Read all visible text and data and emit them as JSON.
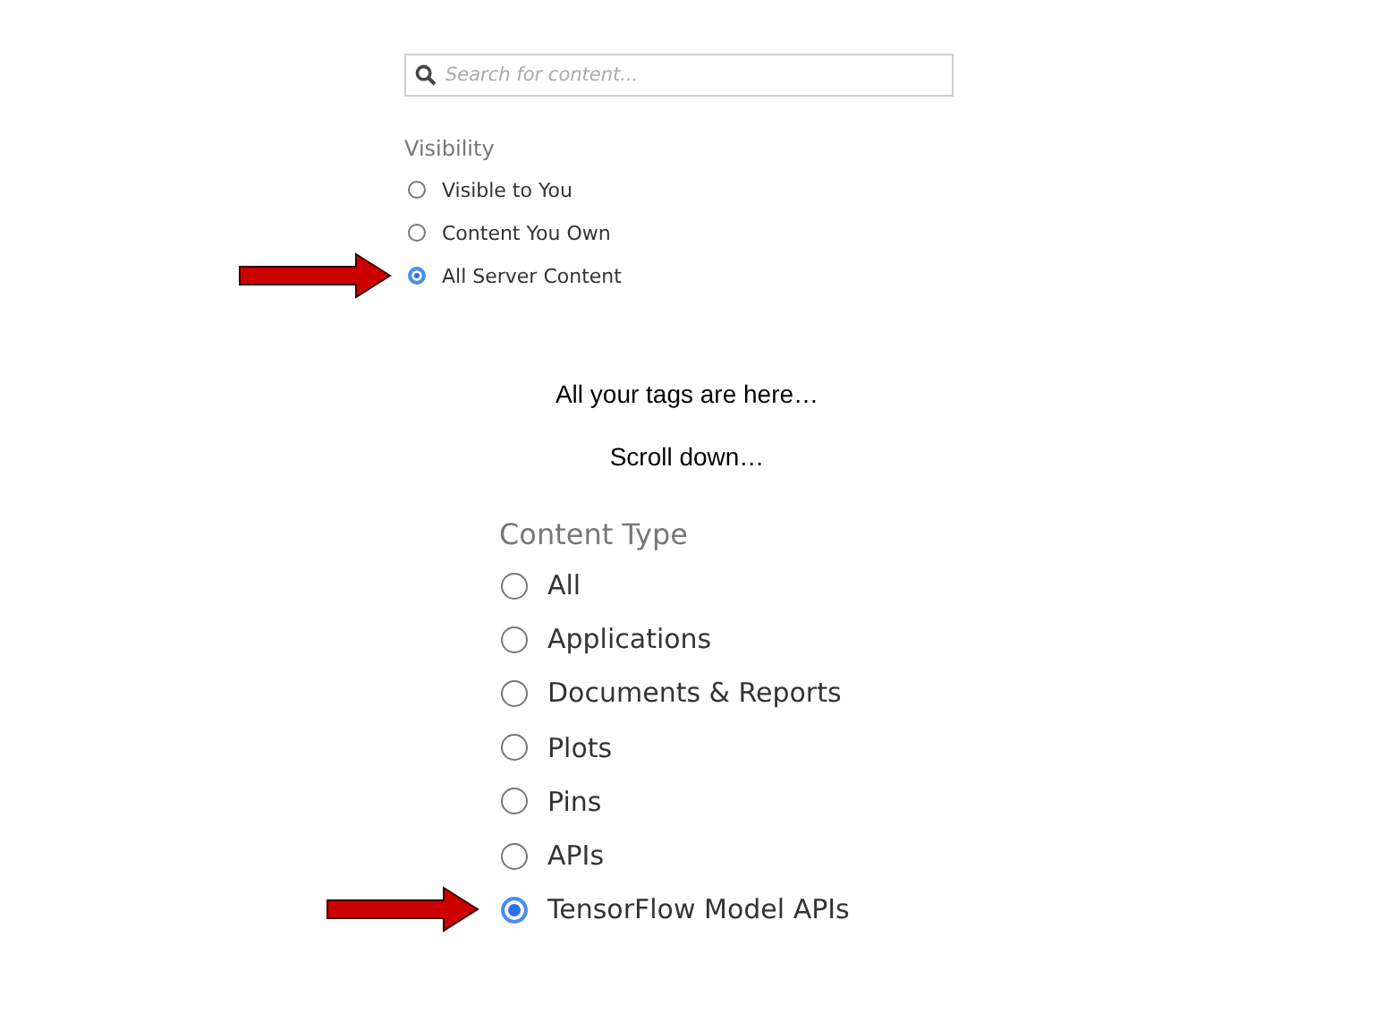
{
  "search": {
    "placeholder": "Search for content..."
  },
  "visibility": {
    "label": "Visibility",
    "options": [
      {
        "label": "Visible to You",
        "selected": false,
        "pointed": false
      },
      {
        "label": "Content You Own",
        "selected": false,
        "pointed": false
      },
      {
        "label": "All Server Content",
        "selected": true,
        "pointed": true
      }
    ]
  },
  "notes": [
    "All your tags are here…",
    "Scroll down…"
  ],
  "content_type": {
    "label": "Content Type",
    "options": [
      {
        "label": "All",
        "selected": false,
        "pointed": false
      },
      {
        "label": "Applications",
        "selected": false,
        "pointed": false
      },
      {
        "label": "Documents & Reports",
        "selected": false,
        "pointed": false
      },
      {
        "label": "Plots",
        "selected": false,
        "pointed": false
      },
      {
        "label": "Pins",
        "selected": false,
        "pointed": false
      },
      {
        "label": "APIs",
        "selected": false,
        "pointed": false
      },
      {
        "label": "TensorFlow Model APIs",
        "selected": true,
        "pointed": true
      }
    ]
  }
}
